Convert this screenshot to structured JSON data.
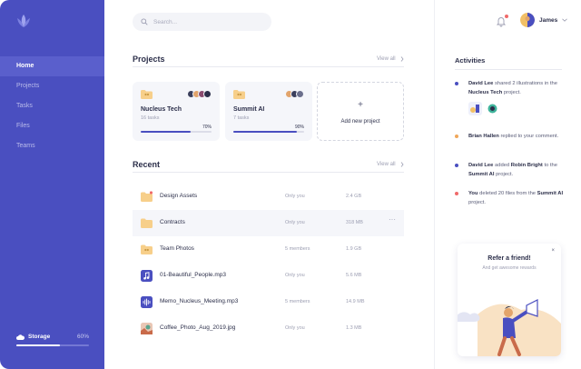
{
  "sidebar": {
    "items": [
      {
        "label": "Home",
        "active": true
      },
      {
        "label": "Projects",
        "active": false
      },
      {
        "label": "Tasks",
        "active": false
      },
      {
        "label": "Files",
        "active": false
      },
      {
        "label": "Teams",
        "active": false
      }
    ],
    "storage": {
      "label": "Storage",
      "percent_text": "60%",
      "fraction": 0.6
    }
  },
  "search": {
    "placeholder": "Search..."
  },
  "projects": {
    "title": "Projects",
    "view_all": "View all",
    "cards": [
      {
        "name": "Nucleus Tech",
        "tasks": "16 tasks",
        "progress_text": "70%",
        "progress": 0.7
      },
      {
        "name": "Summit AI",
        "tasks": "7 tasks",
        "progress_text": "90%",
        "progress": 0.9
      }
    ],
    "add_label": "Add new project"
  },
  "recent": {
    "title": "Recent",
    "view_all": "View all",
    "files": [
      {
        "name": "Design Assets",
        "share": "Only you",
        "size": "2.4 GB",
        "icon": "folder-icon"
      },
      {
        "name": "Contracts",
        "share": "Only you",
        "size": "318 MB",
        "icon": "folder-icon"
      },
      {
        "name": "Team Photos",
        "share": "5 members",
        "size": "1.9 GB",
        "icon": "shared-folder-icon"
      },
      {
        "name": "01-Beautiful_People.mp3",
        "share": "Only you",
        "size": "5.6 MB",
        "icon": "music-icon"
      },
      {
        "name": "Memo_Nucleus_Meeting.mp3",
        "share": "5 members",
        "size": "14.9 MB",
        "icon": "audio-wave-icon"
      },
      {
        "name": "Coffee_Photo_Aug_2019.jpg",
        "share": "Only you",
        "size": "1.3 MB",
        "icon": "image-thumb-icon"
      }
    ],
    "more_label": "···"
  },
  "header": {
    "user_name": "James"
  },
  "activities": {
    "title": "Activities",
    "items": [
      {
        "actor": "David Lee",
        "text": " shared 2 illustrations in the ",
        "target": "Nucleus Tech",
        "tail": " project.",
        "color": "#4a4fc0"
      },
      {
        "actor": "Brian Hallen",
        "text": " replied to your comment.",
        "target": "",
        "tail": "",
        "color": "#f0a75a"
      },
      {
        "actor": "David Lee",
        "text": " added ",
        "target": "Robin Bright",
        "tail": " to the ",
        "target2": "Summit AI",
        "tail2": " project.",
        "color": "#4a4fc0"
      },
      {
        "actor": "You",
        "text": " deleted 20 files from the ",
        "target": "Summit AI",
        "tail": " project.",
        "color": "#f06a6a"
      }
    ]
  },
  "refer": {
    "title": "Refer a friend!",
    "subtitle": "And get awesome rewards",
    "close": "×"
  },
  "colors": {
    "accent": "#4a4fc0",
    "folder": "#f7cf8a",
    "danger": "#f06a6a",
    "warning": "#f0a75a"
  }
}
